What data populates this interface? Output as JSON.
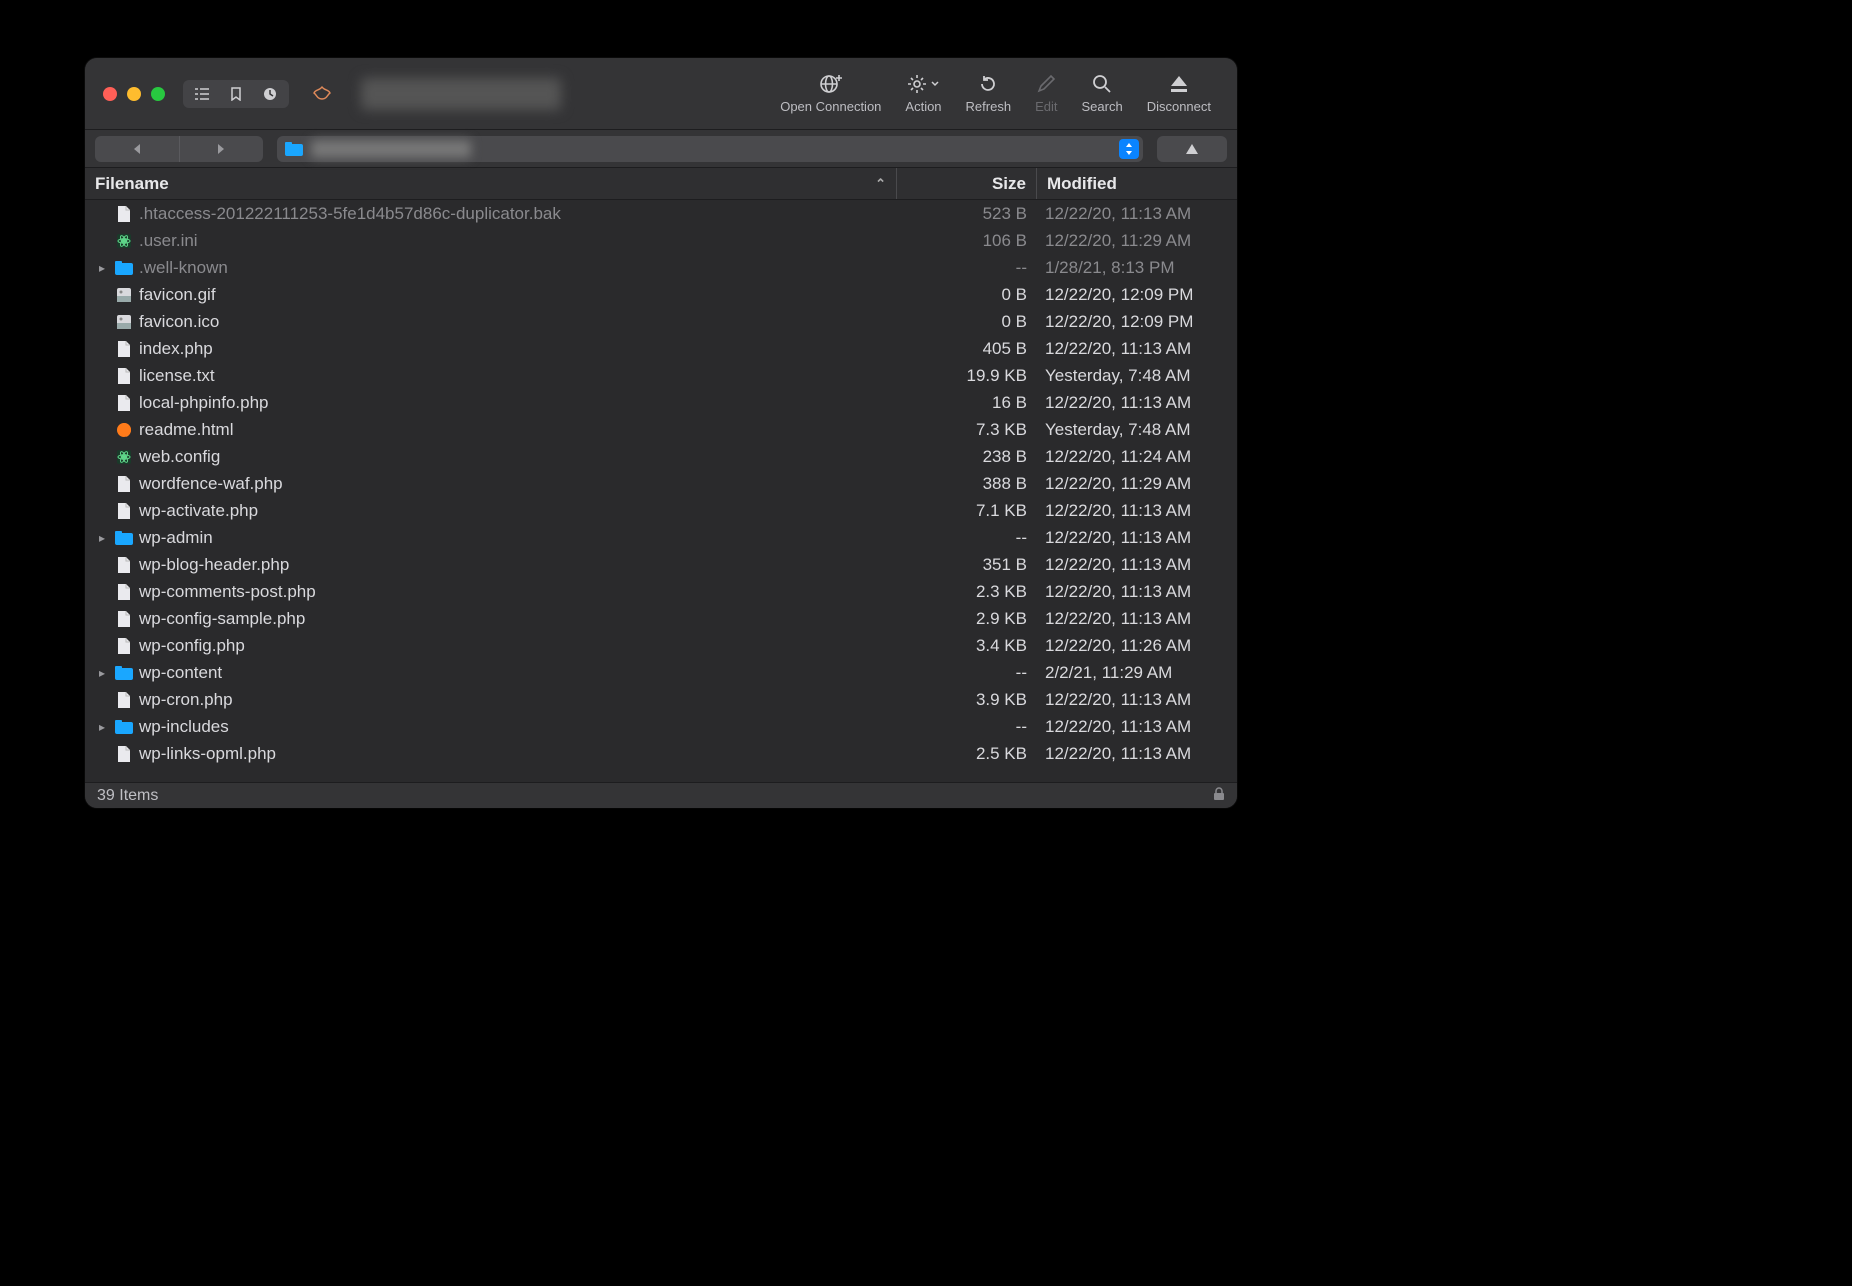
{
  "window_title": "████████",
  "toolbar": {
    "open_connection": "Open Connection",
    "action": "Action",
    "refresh": "Refresh",
    "edit": "Edit",
    "search": "Search",
    "disconnect": "Disconnect"
  },
  "path_label": "████████",
  "columns": {
    "filename": "Filename",
    "size": "Size",
    "modified": "Modified"
  },
  "files": [
    {
      "name": ".htaccess-201222111253-5fe1d4b57d86c-duplicator.bak",
      "size": "523 B",
      "modified": "12/22/20, 11:13 AM",
      "kind": "file",
      "hidden": true
    },
    {
      "name": ".user.ini",
      "size": "106 B",
      "modified": "12/22/20, 11:29 AM",
      "kind": "atom",
      "hidden": true
    },
    {
      "name": ".well-known",
      "size": "--",
      "modified": "1/28/21, 8:13 PM",
      "kind": "folder",
      "hidden": true
    },
    {
      "name": "favicon.gif",
      "size": "0 B",
      "modified": "12/22/20, 12:09 PM",
      "kind": "image"
    },
    {
      "name": "favicon.ico",
      "size": "0 B",
      "modified": "12/22/20, 12:09 PM",
      "kind": "image"
    },
    {
      "name": "index.php",
      "size": "405 B",
      "modified": "12/22/20, 11:13 AM",
      "kind": "file"
    },
    {
      "name": "license.txt",
      "size": "19.9 KB",
      "modified": "Yesterday, 7:48 AM",
      "kind": "file"
    },
    {
      "name": "local-phpinfo.php",
      "size": "16 B",
      "modified": "12/22/20, 11:13 AM",
      "kind": "file"
    },
    {
      "name": "readme.html",
      "size": "7.3 KB",
      "modified": "Yesterday, 7:48 AM",
      "kind": "firefox"
    },
    {
      "name": "web.config",
      "size": "238 B",
      "modified": "12/22/20, 11:24 AM",
      "kind": "atom"
    },
    {
      "name": "wordfence-waf.php",
      "size": "388 B",
      "modified": "12/22/20, 11:29 AM",
      "kind": "file"
    },
    {
      "name": "wp-activate.php",
      "size": "7.1 KB",
      "modified": "12/22/20, 11:13 AM",
      "kind": "file"
    },
    {
      "name": "wp-admin",
      "size": "--",
      "modified": "12/22/20, 11:13 AM",
      "kind": "folder"
    },
    {
      "name": "wp-blog-header.php",
      "size": "351 B",
      "modified": "12/22/20, 11:13 AM",
      "kind": "file"
    },
    {
      "name": "wp-comments-post.php",
      "size": "2.3 KB",
      "modified": "12/22/20, 11:13 AM",
      "kind": "file"
    },
    {
      "name": "wp-config-sample.php",
      "size": "2.9 KB",
      "modified": "12/22/20, 11:13 AM",
      "kind": "file"
    },
    {
      "name": "wp-config.php",
      "size": "3.4 KB",
      "modified": "12/22/20, 11:26 AM",
      "kind": "file"
    },
    {
      "name": "wp-content",
      "size": "--",
      "modified": "2/2/21, 11:29 AM",
      "kind": "folder"
    },
    {
      "name": "wp-cron.php",
      "size": "3.9 KB",
      "modified": "12/22/20, 11:13 AM",
      "kind": "file"
    },
    {
      "name": "wp-includes",
      "size": "--",
      "modified": "12/22/20, 11:13 AM",
      "kind": "folder"
    },
    {
      "name": "wp-links-opml.php",
      "size": "2.5 KB",
      "modified": "12/22/20, 11:13 AM",
      "kind": "file"
    }
  ],
  "status": {
    "item_count": "39 Items"
  }
}
